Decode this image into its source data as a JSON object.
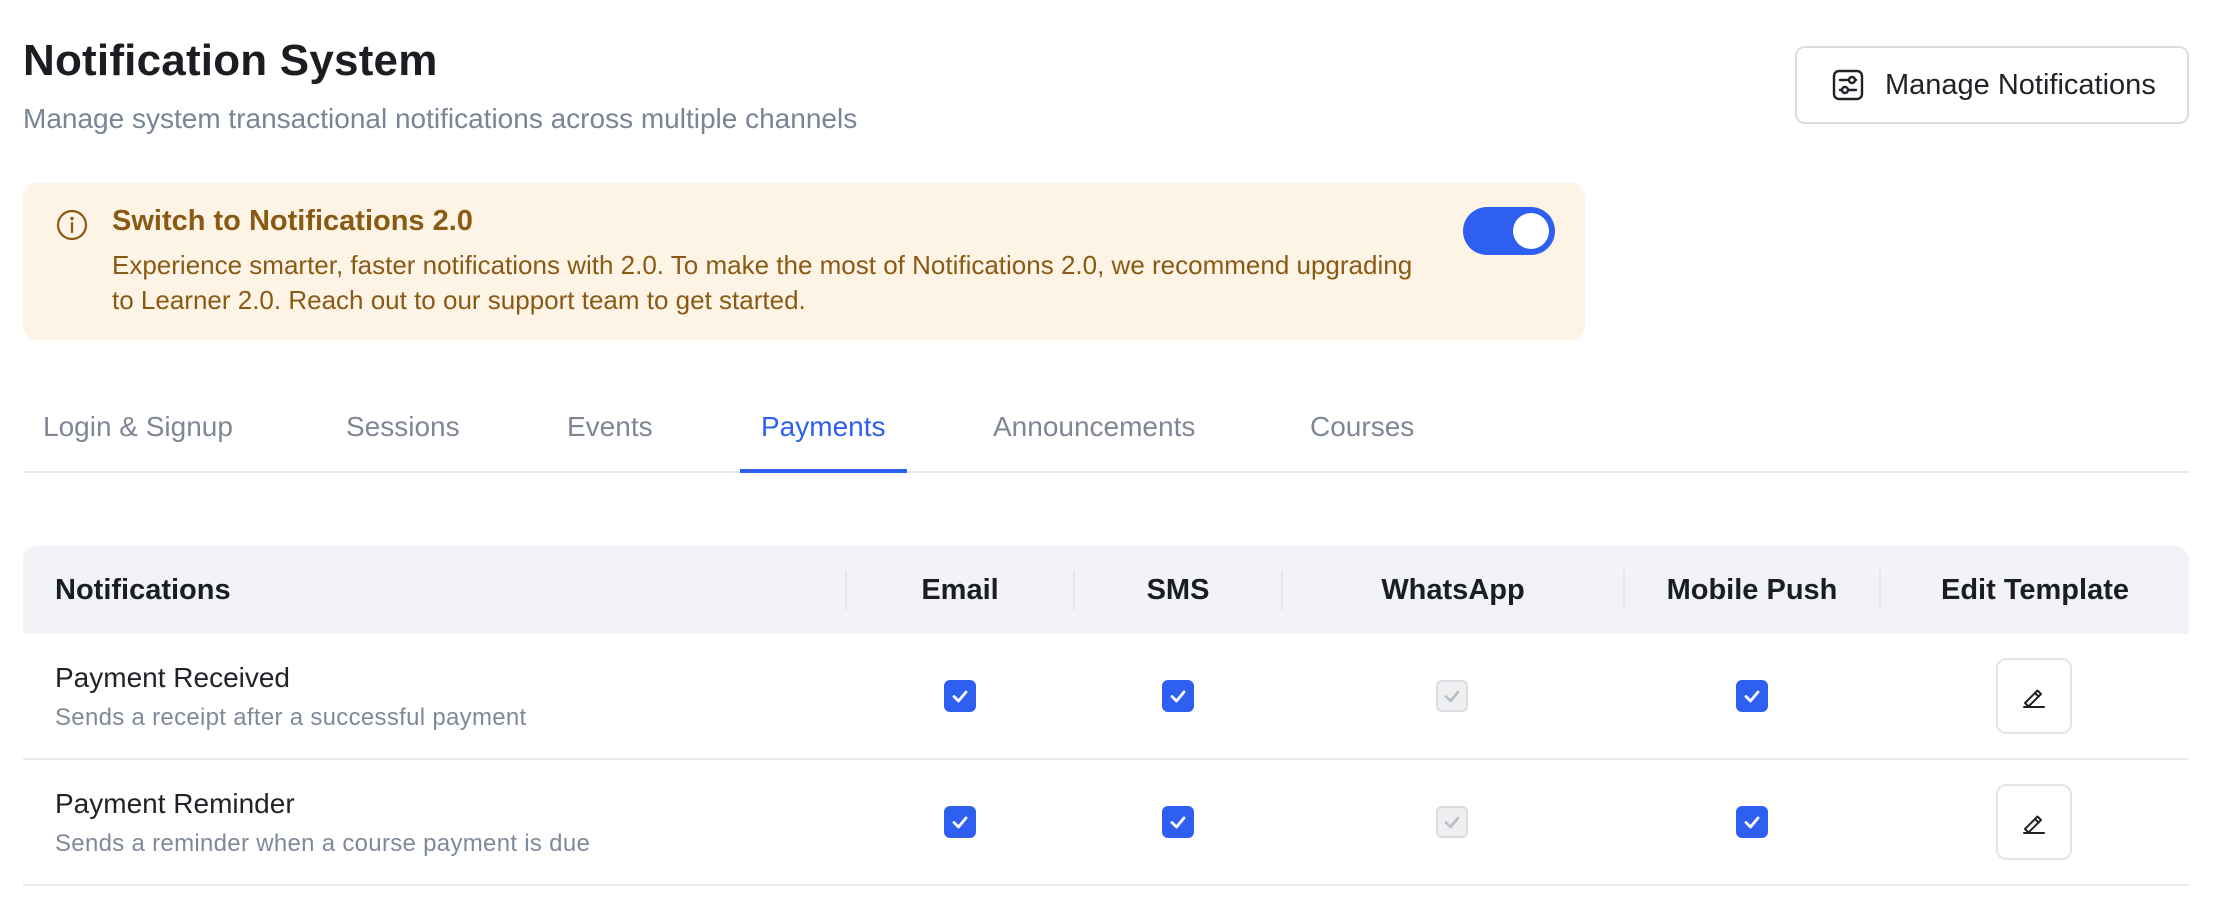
{
  "header": {
    "title": "Notification System",
    "subtitle": "Manage system transactional notifications across multiple channels",
    "manage_button_label": "Manage Notifications",
    "manage_button_icon": "sliders-settings-icon"
  },
  "banner": {
    "icon": "info-icon",
    "title": "Switch to Notifications 2.0",
    "text": "Experience smarter, faster notifications with 2.0. To make the most of Notifications 2.0, we recommend upgrading to Learner 2.0. Reach out to our support team to get started.",
    "toggle_on": true,
    "background_color": "#fdf4e6",
    "text_color": "#8a5a14"
  },
  "tabs": [
    {
      "label": "Login & Signup",
      "active": false
    },
    {
      "label": "Sessions",
      "active": false
    },
    {
      "label": "Events",
      "active": false
    },
    {
      "label": "Payments",
      "active": true
    },
    {
      "label": "Announcements",
      "active": false
    },
    {
      "label": "Courses",
      "active": false
    }
  ],
  "table": {
    "columns": [
      "Notifications",
      "Email",
      "SMS",
      "WhatsApp",
      "Mobile Push",
      "Edit Template"
    ],
    "rows": [
      {
        "name": "Payment Received",
        "description": "Sends a receipt after a successful payment",
        "email": "checked",
        "sms": "checked",
        "whatsapp": "checked-disabled",
        "mobile_push": "checked"
      },
      {
        "name": "Payment Reminder",
        "description": "Sends a reminder when a course payment is due",
        "email": "checked",
        "sms": "checked",
        "whatsapp": "checked-disabled",
        "mobile_push": "checked"
      }
    ],
    "edit_icon": "pencil-edit-icon"
  },
  "colors": {
    "accent": "#2f5ff0",
    "muted_text": "#7f8794"
  }
}
